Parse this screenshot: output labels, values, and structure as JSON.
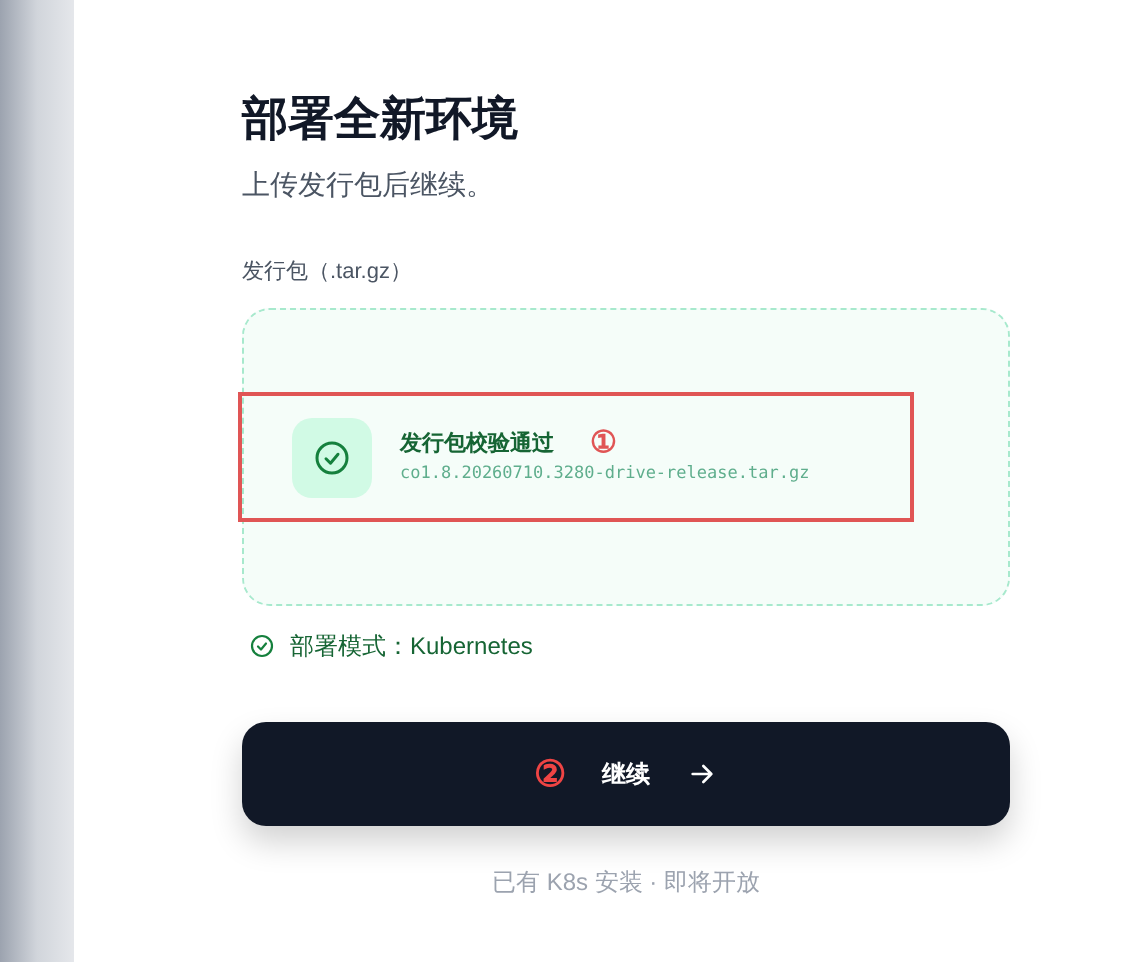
{
  "title": "部署全新环境",
  "subtitle": "上传发行包后继续。",
  "upload": {
    "label": "发行包（.tar.gz）",
    "status": "发行包校验通过",
    "filename": "co1.8.20260710.3280-drive-release.tar.gz",
    "annotation": "①"
  },
  "mode": "部署模式：Kubernetes",
  "continue_button": {
    "label": "继续",
    "annotation": "②"
  },
  "footer": "已有 K8s 安装 · 即将开放"
}
